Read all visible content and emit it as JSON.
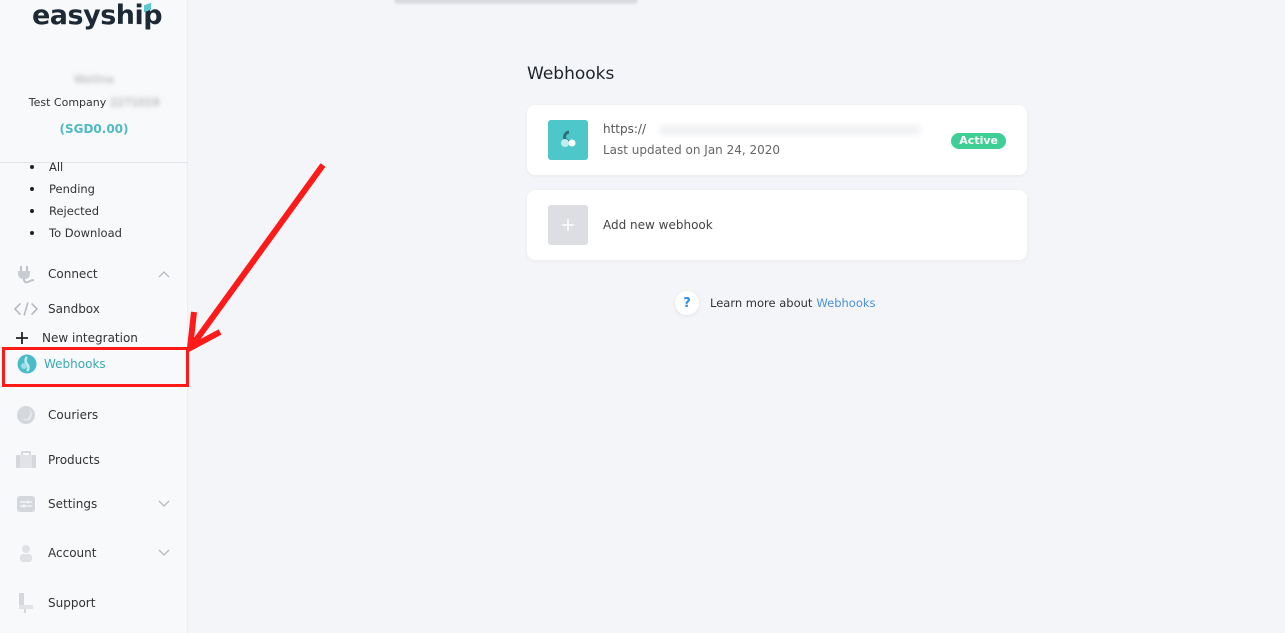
{
  "brand": {
    "logo_text": "easyship",
    "accent_color": "#4fb9c6"
  },
  "account": {
    "user_name": "Wellina",
    "company": "Test Company",
    "company_suffix": "2271019",
    "balance": "(SGD0.00)"
  },
  "sidebar": {
    "sub_items": [
      "All",
      "Pending",
      "Rejected",
      "To Download"
    ],
    "items": [
      {
        "label": "Connect",
        "icon": "plug-icon",
        "expanded": true
      },
      {
        "label": "Sandbox",
        "icon": "code-icon"
      },
      {
        "label": "New integration",
        "icon": "plus-icon"
      },
      {
        "label": "Webhooks",
        "icon": "webhook-icon",
        "active": true
      },
      {
        "label": "Couriers",
        "icon": "courier-icon"
      },
      {
        "label": "Products",
        "icon": "products-icon"
      },
      {
        "label": "Settings",
        "icon": "settings-icon",
        "expanded": false
      },
      {
        "label": "Account",
        "icon": "account-icon",
        "expanded": false
      },
      {
        "label": "Support",
        "icon": "support-icon"
      }
    ]
  },
  "main": {
    "title": "Webhooks",
    "webhooks": [
      {
        "url": "https://",
        "updated": "Last updated on Jan 24, 2020",
        "status": "Active",
        "status_color": "#3fcf96"
      }
    ],
    "add_label": "Add new webhook",
    "learn_more": {
      "text": "Learn more about",
      "link": "Webhooks",
      "icon": "?"
    }
  },
  "annotation": {
    "color": "#ff1a1a"
  }
}
